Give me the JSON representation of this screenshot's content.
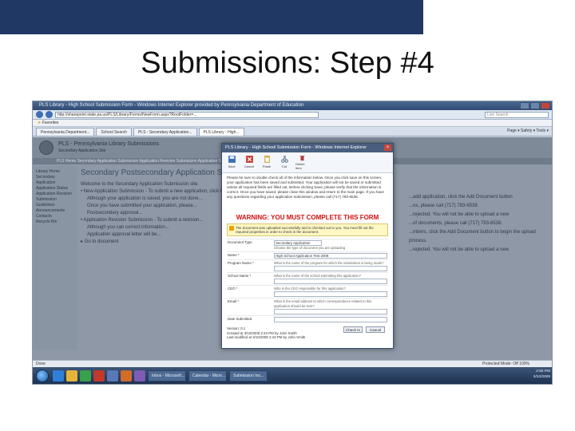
{
  "slide": {
    "title": "Submissions: Step #4"
  },
  "browser": {
    "window_title": "PLS Library - High School Submission Form - Windows Internet Explorer provided by Pennsylvania Department of Education",
    "url": "http://sharepoint.state.pa.us/PLS/Library/Forms/NewForm.aspx?RootFolder=...",
    "search_placeholder": "Live Search",
    "favorites_label": "Favorites",
    "tabs": [
      "Pennsylvania Department...",
      "School Search",
      "PLS - Secondary Application...",
      "PLS Library - High..."
    ],
    "command_bar": "Page ▾  Safety ▾  Tools ▾"
  },
  "sharepoint": {
    "site_title": "PLS - Pennsylvania Library Submissions",
    "site_subtitle": "Secondary Application Site",
    "topnav": "PLS Home   Secondary Application Submission   Application Revision Submission   Application Status",
    "left_nav": [
      "Library Home",
      "Secondary Application",
      "Application Status",
      "Application Revision",
      "Submission Guidelines",
      "Announcements",
      "Contacts",
      "Recycle Bin"
    ],
    "page_title": "Secondary Postsecondary Application Submission",
    "main_lines": [
      "Welcome to the Secondary Application Submission site.",
      "• New Application Submission - To submit a new application, click the link below:",
      "Although your application is saved, you are not done...",
      "Once you have submitted your application, please...",
      "Postsecondary approval...",
      "• Application Revision Submission - To submit a revision...",
      "Although you can correct information...",
      "Application approval letter will be...",
      "▸ Go to document"
    ],
    "right_lines": [
      "...add application, click the Add Document button",
      "...ns, please call (717) 783-6538.",
      "...rejected. You will not be able to upload a new",
      "...of documents, please call (717) 783-6538.",
      "...mbers, click the Add Document button to begin the upload process.",
      "...rejected. You will not be able to upload a new"
    ]
  },
  "dialog": {
    "title": "PLS Library - High School Submission Form - Windows Internet Explorer",
    "ribbon": [
      {
        "label": "Save",
        "icon": "save-icon",
        "color": "#3a6fb3"
      },
      {
        "label": "Cancel",
        "icon": "cancel-icon",
        "color": "#c43d2c"
      },
      {
        "label": "Paste",
        "icon": "paste-icon",
        "color": "#d3a43a"
      },
      {
        "label": "Cut",
        "icon": "cut-icon",
        "color": "#6a7d95"
      },
      {
        "label": "Delete Item",
        "icon": "delete-icon",
        "color": "#b53a3a"
      }
    ],
    "intro": "Please be sure to double check all of the information below. Once you click save on this screen, your application has been saved and submitted. Your application will not be saved or submitted unless all required fields are filled out. Before clicking Save, please verify that the information is correct. Once you have saved, please close this window and return to the main page. If you have any questions regarding your application submission, please call (717) 783-6538.",
    "warning": "WARNING: YOU MUST COMPLETE THIS FORM",
    "alert": "The document was uploaded successfully and is checked out to you. You must fill out the required properties in order to check in the document.",
    "fields": [
      {
        "label": "Document Type",
        "type": "select",
        "value": "Secondary Application",
        "desc": "Choose the type of document you are uploading"
      },
      {
        "label": "Name *",
        "type": "input",
        "value": "High School Application Test 2009",
        "desc": ""
      },
      {
        "label": "Program Name *",
        "type": "input",
        "value": "",
        "desc": "What is the name of the program for which the submission is being made?"
      },
      {
        "label": "School Name *",
        "type": "input",
        "value": "",
        "desc": "What is the name of the school submitting this application?"
      },
      {
        "label": "CEO *",
        "type": "input",
        "value": "",
        "desc": "Who is the CEO responsible for this application?"
      },
      {
        "label": "Email *",
        "type": "input",
        "value": "",
        "desc": "What is the email address to which correspondence related to this application should be sent?"
      },
      {
        "label": "Date Submitted",
        "type": "input",
        "value": "",
        "desc": ""
      }
    ],
    "footer_lines": [
      "Version: 0.1",
      "Created at 3/10/2009 2:43 PM by John Smith",
      "Last modified at 3/10/2009 2:43 PM by John Smith"
    ],
    "ok_label": "Check In",
    "cancel_label": "Cancel"
  },
  "status_bar": {
    "left": "Done",
    "right": "Protected Mode: Off   100%"
  },
  "taskbar": {
    "tasks": [
      "Inbox - Microsoft...",
      "Calendar - Micro...",
      "Submission Ins..."
    ],
    "clock": "2:55 PM",
    "date": "3/10/2009"
  },
  "colors": {
    "header_bar": "#1f3864",
    "warning": "#d01010"
  }
}
